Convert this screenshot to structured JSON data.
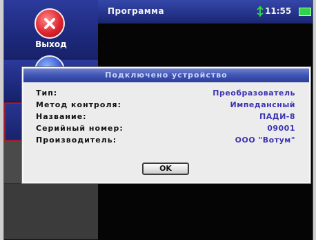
{
  "sidebar": {
    "exit_label": "Выход",
    "exit_icon": "close-icon",
    "second_icon": "info-icon"
  },
  "topbar": {
    "title": "Программа",
    "time": "11:55",
    "connection_icon": "usb-icon",
    "battery_icon": "battery-icon"
  },
  "dialog": {
    "title": "Подключено устройство",
    "rows": [
      {
        "label": "Тип:",
        "value": "Преобразователь"
      },
      {
        "label": "Метод контроля:",
        "value": "Импедансный"
      },
      {
        "label": "Название:",
        "value": "ПАДИ-8"
      },
      {
        "label": "Серийный номер:",
        "value": "09001"
      },
      {
        "label": "Производитель:",
        "value": "ООО \"Вотум\""
      }
    ],
    "ok_label": "OK"
  },
  "colors": {
    "menu_blue": "#24328a",
    "exit_red": "#e0242e",
    "value_blue": "#3b33b2",
    "battery_green": "#2fd44a"
  }
}
